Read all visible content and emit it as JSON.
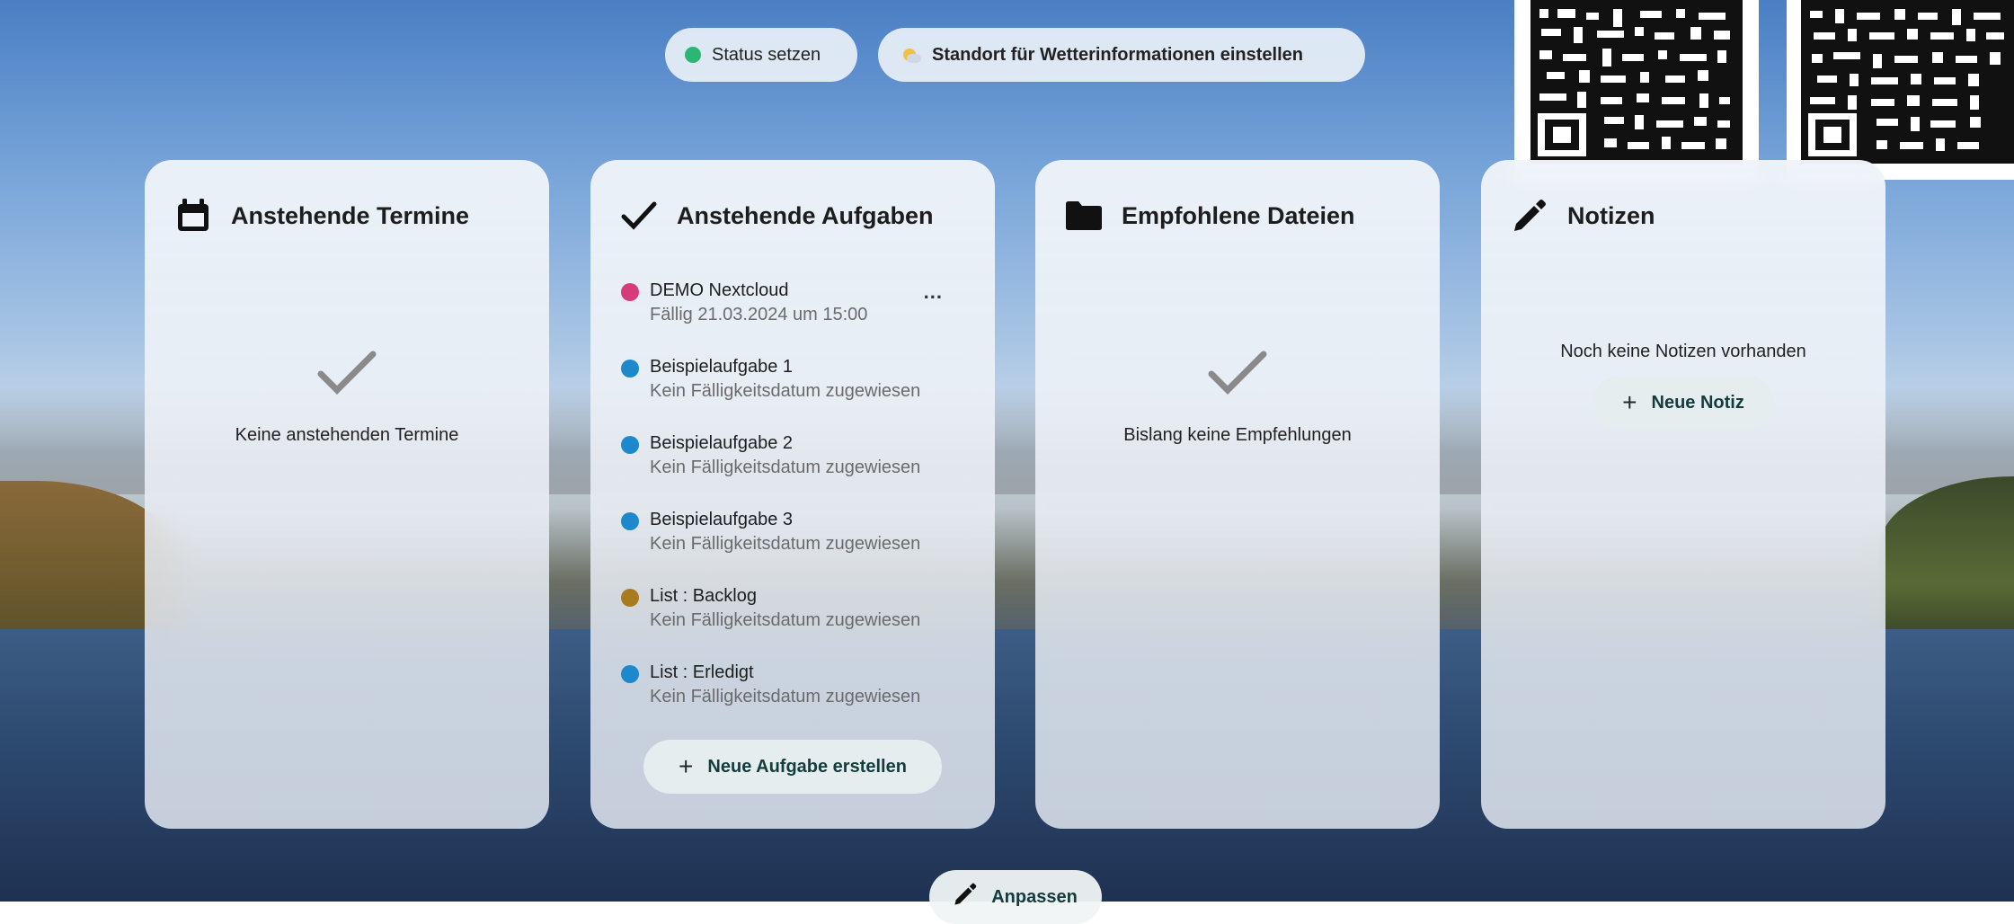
{
  "header": {
    "status_label": "Status setzen",
    "status_color": "#2bb673",
    "weather_label": "Standort für Wetterinformationen einstellen"
  },
  "widgets": {
    "calendar": {
      "title": "Anstehende Termine",
      "icon": "calendar-icon",
      "empty_text": "Keine anstehenden Termine"
    },
    "tasks": {
      "title": "Anstehende Aufgaben",
      "icon": "checkmark-icon",
      "items": [
        {
          "title": "DEMO Nextcloud",
          "subtitle": "Fällig 21.03.2024 um 15:00",
          "color": "#d63b7a"
        },
        {
          "title": "Beispielaufgabe 1",
          "subtitle": "Kein Fälligkeitsdatum zugewiesen",
          "color": "#1e88cc"
        },
        {
          "title": "Beispielaufgabe 2",
          "subtitle": "Kein Fälligkeitsdatum zugewiesen",
          "color": "#1e88cc"
        },
        {
          "title": "Beispielaufgabe 3",
          "subtitle": "Kein Fälligkeitsdatum zugewiesen",
          "color": "#1e88cc"
        },
        {
          "title": "List : Backlog",
          "subtitle": "Kein Fälligkeitsdatum zugewiesen",
          "color": "#a67c1f"
        },
        {
          "title": "List : Erledigt",
          "subtitle": "Kein Fälligkeitsdatum zugewiesen",
          "color": "#1e88cc"
        }
      ],
      "more_label": "...",
      "add_label": "Neue Aufgabe erstellen"
    },
    "files": {
      "title": "Empfohlene Dateien",
      "icon": "folder-icon",
      "empty_text": "Bislang keine Empfehlungen"
    },
    "notes": {
      "title": "Notizen",
      "icon": "pencil-icon",
      "empty_text": "Noch keine Notizen vorhanden",
      "add_label": "Neue Notiz"
    }
  },
  "footer": {
    "customize_label": "Anpassen"
  }
}
